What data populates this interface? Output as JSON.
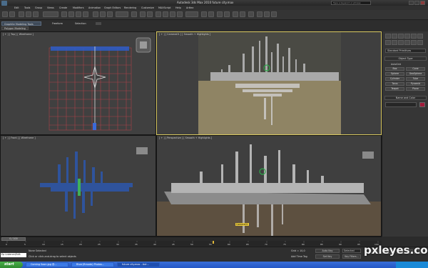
{
  "window": {
    "title": "Autodesk 3ds Max  2010      future city.max",
    "search_placeholder": "Type a keyword or phrase"
  },
  "menu": [
    "Edit",
    "Tools",
    "Group",
    "Views",
    "Create",
    "Modifiers",
    "Animation",
    "Graph Editors",
    "Rendering",
    "Customize",
    "MAXScript",
    "Help",
    "Arttez"
  ],
  "ribbon": {
    "tabs": [
      "Graphite Modeling Tools",
      "Freeform",
      "Selection"
    ],
    "sub_tab": "Polygon Modeling"
  },
  "viewports": {
    "top": "[ + ] [ Top ] [ Wireframe ]",
    "camera": "[ + ] [ Camera01 ] [ Smooth + Highlights ]",
    "front": "[ + ] [ Front ] [ Wireframe ]",
    "perspective": "[ + ] [ Perspective ] [ Smooth + Highlights ]",
    "camera_tag": "Camera01"
  },
  "command_panel": {
    "dropdown": "Standard Primitives",
    "object_type_title": "Object Type",
    "autogrid_label": "AutoGrid",
    "buttons": [
      "Box",
      "Cone",
      "Sphere",
      "GeoSphere",
      "Cylinder",
      "Tube",
      "Torus",
      "Pyramid",
      "Teapot",
      "Plane"
    ],
    "name_color_title": "Name and Color",
    "swatch_color": "#a11a3a"
  },
  "timeline": {
    "thumb": "0 / 100",
    "ticks": [
      "0",
      "5",
      "10",
      "15",
      "20",
      "25",
      "30",
      "35",
      "40",
      "45",
      "50",
      "55",
      "60",
      "65",
      "70",
      "75",
      "80",
      "85",
      "90",
      "95",
      "100"
    ]
  },
  "status": {
    "maxscript": "Ep Listener/Edit",
    "line1": "None Selected",
    "line2": "Click or click-and-drag to select objects",
    "grid": "Grid = 10,0",
    "add_time_tag": "Add Time Tag",
    "auto_key": "Auto Key",
    "set_key": "Set Key",
    "selected": "Selected",
    "key_filters": "Key Filters..."
  },
  "taskbar": {
    "start": "start",
    "items": [
      "Coming Soon.jpg @...",
      "River(Rmode) Photos...",
      "future city.max - Aut..."
    ]
  },
  "watermark": "pxleyes.com"
}
